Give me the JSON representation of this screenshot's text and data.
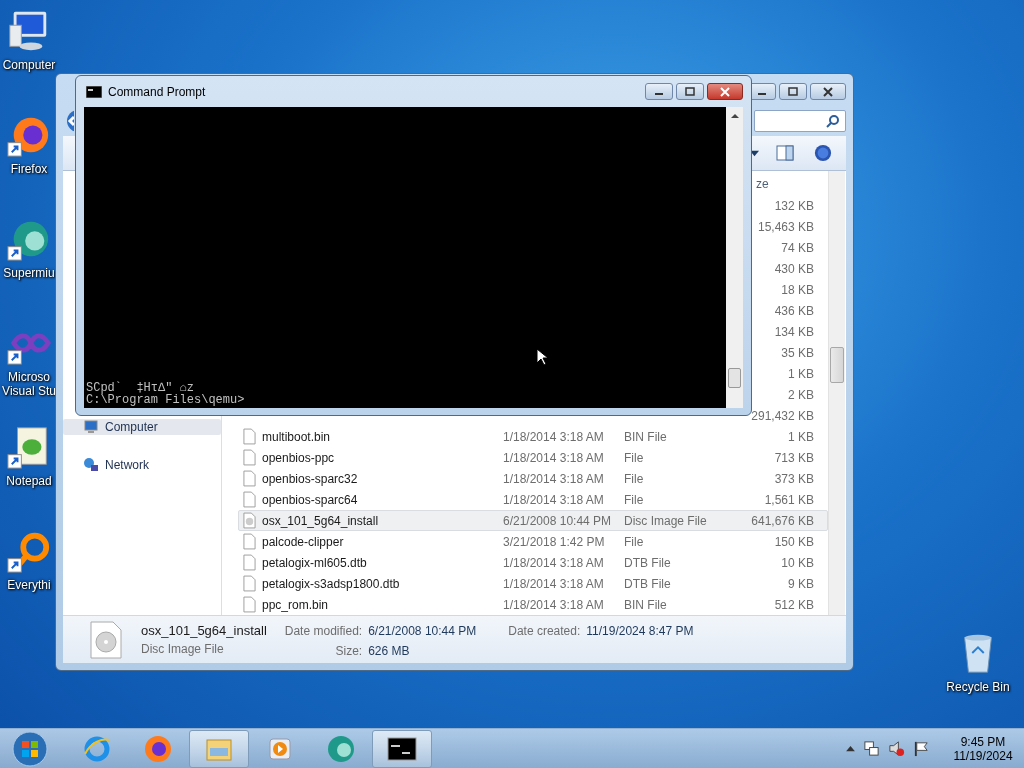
{
  "desktop_icons": [
    {
      "kind": "computer",
      "shortcut": false,
      "lines": [
        "Computer"
      ]
    },
    {
      "kind": "firefox",
      "shortcut": true,
      "lines": [
        "Firefox"
      ]
    },
    {
      "kind": "supermium",
      "shortcut": true,
      "lines": [
        "Supermiu"
      ]
    },
    {
      "kind": "studio",
      "shortcut": true,
      "lines": [
        "Microso",
        "Visual Stu"
      ]
    },
    {
      "kind": "notepad",
      "shortcut": true,
      "lines": [
        "Notepad"
      ]
    },
    {
      "kind": "everything",
      "shortcut": true,
      "lines": [
        "Everythi"
      ]
    }
  ],
  "recycle_bin": {
    "label": "Recycle Bin"
  },
  "explorer": {
    "sidebar": [
      {
        "kind": "computer",
        "label": "Computer",
        "selected": true
      },
      {
        "kind": "network",
        "label": "Network",
        "selected": false
      }
    ],
    "column_header": "ze",
    "rows": [
      {
        "size": "132 KB",
        "selected": false
      },
      {
        "size": "15,463 KB",
        "selected": false
      },
      {
        "size": "74 KB",
        "selected": false
      },
      {
        "size": "430 KB",
        "selected": false
      },
      {
        "size": "18 KB",
        "selected": false
      },
      {
        "size": "436 KB",
        "selected": false
      },
      {
        "size": "134 KB",
        "selected": false
      },
      {
        "size": "35 KB",
        "selected": false
      },
      {
        "size": "1 KB",
        "selected": false
      },
      {
        "size": "2 KB",
        "selected": false
      },
      {
        "size": "291,432 KB",
        "selected": false
      },
      {
        "kind": "file",
        "name": "multiboot.bin",
        "date": "1/18/2014 3:18 AM",
        "type": "BIN File",
        "size": "1 KB",
        "selected": false
      },
      {
        "kind": "file",
        "name": "openbios-ppc",
        "date": "1/18/2014 3:18 AM",
        "type": "File",
        "size": "713 KB",
        "selected": false
      },
      {
        "kind": "file",
        "name": "openbios-sparc32",
        "date": "1/18/2014 3:18 AM",
        "type": "File",
        "size": "373 KB",
        "selected": false
      },
      {
        "kind": "file",
        "name": "openbios-sparc64",
        "date": "1/18/2014 3:18 AM",
        "type": "File",
        "size": "1,561 KB",
        "selected": false
      },
      {
        "kind": "disc",
        "name": "osx_101_5g64_install",
        "date": "6/21/2008 10:44 PM",
        "type": "Disc Image File",
        "size": "641,676 KB",
        "selected": true
      },
      {
        "kind": "file",
        "name": "palcode-clipper",
        "date": "3/21/2018 1:42 PM",
        "type": "File",
        "size": "150 KB",
        "selected": false
      },
      {
        "kind": "file",
        "name": "petalogix-ml605.dtb",
        "date": "1/18/2014 3:18 AM",
        "type": "DTB File",
        "size": "10 KB",
        "selected": false
      },
      {
        "kind": "file",
        "name": "petalogix-s3adsp1800.dtb",
        "date": "1/18/2014 3:18 AM",
        "type": "DTB File",
        "size": "9 KB",
        "selected": false
      },
      {
        "kind": "file",
        "name": "ppc_rom.bin",
        "date": "1/18/2014 3:18 AM",
        "type": "BIN File",
        "size": "512 KB",
        "selected": false
      }
    ],
    "details": {
      "name": "osx_101_5g64_install",
      "type": "Disc Image File",
      "modified_label": "Date modified:",
      "modified": "6/21/2008 10:44 PM",
      "size_label": "Size:",
      "size": "626 MB",
      "created_label": "Date created:",
      "created": "11/19/2024 8:47 PM"
    }
  },
  "command_prompt": {
    "title": "Command Prompt",
    "lines": [
      "SCpd`  ‡Hτ∆\" ⌂z",
      "C:\\Program Files\\qemu>"
    ]
  },
  "taskbar": {
    "items": [
      {
        "kind": "start",
        "active": false
      },
      {
        "kind": "ie",
        "active": false
      },
      {
        "kind": "firefox",
        "active": false
      },
      {
        "kind": "explorer",
        "active": true
      },
      {
        "kind": "media",
        "active": false
      },
      {
        "kind": "supermium",
        "active": false
      },
      {
        "kind": "cmd",
        "active": true
      }
    ],
    "clock": {
      "time": "9:45 PM",
      "date": "11/19/2024"
    }
  }
}
